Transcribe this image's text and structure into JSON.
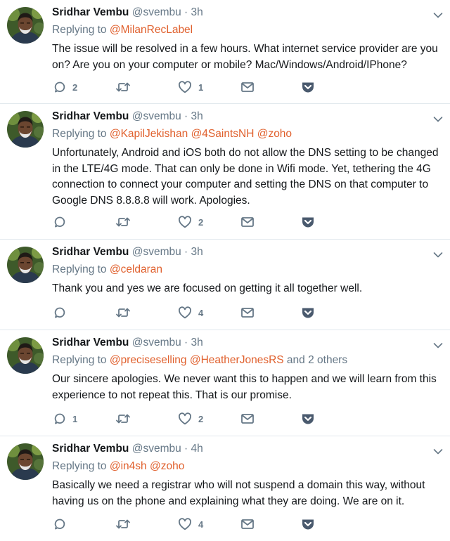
{
  "tweets": [
    {
      "name": "Sridhar Vembu",
      "handle": "@svembu",
      "sep": "·",
      "time": "3h",
      "replying_label": "Replying to",
      "mentions": [
        "@MilanRecLabel"
      ],
      "others_text": "",
      "text": "The issue will be resolved in a few hours. What internet service provider are you on? Are you on your computer or mobile? Mac/Windows/Android/IPhone?",
      "reply_count": "2",
      "retweet_count": "",
      "like_count": "1"
    },
    {
      "name": "Sridhar Vembu",
      "handle": "@svembu",
      "sep": "·",
      "time": "3h",
      "replying_label": "Replying to",
      "mentions": [
        "@KapilJekishan",
        "@4SaintsNH",
        "@zoho"
      ],
      "others_text": "",
      "text": "Unfortunately, Android and iOS both do not allow the DNS setting to be changed in the LTE/4G mode. That can only be done in Wifi mode. Yet, tethering the 4G connection to connect your computer and setting the DNS on that computer to Google DNS 8.8.8.8 will work. Apologies.",
      "reply_count": "",
      "retweet_count": "",
      "like_count": "2"
    },
    {
      "name": "Sridhar Vembu",
      "handle": "@svembu",
      "sep": "·",
      "time": "3h",
      "replying_label": "Replying to",
      "mentions": [
        "@celdaran"
      ],
      "others_text": "",
      "text": "Thank you and yes we are focused on getting it all together well.",
      "reply_count": "",
      "retweet_count": "",
      "like_count": "4"
    },
    {
      "name": "Sridhar Vembu",
      "handle": "@svembu",
      "sep": "·",
      "time": "3h",
      "replying_label": "Replying to",
      "mentions": [
        "@preciseselling",
        "@HeatherJonesRS"
      ],
      "others_text": "and 2 others",
      "text": "Our sincere apologies. We never want this to happen and we will learn from this experience to not repeat this. That is our promise.",
      "reply_count": "1",
      "retweet_count": "",
      "like_count": "2"
    },
    {
      "name": "Sridhar Vembu",
      "handle": "@svembu",
      "sep": "·",
      "time": "4h",
      "replying_label": "Replying to",
      "mentions": [
        "@in4sh",
        "@zoho"
      ],
      "others_text": "",
      "text": "Basically we need a registrar who will not suspend a domain this way, without having us on the phone and explaining what they are doing. We are on it.",
      "reply_count": "",
      "retweet_count": "",
      "like_count": "4"
    }
  ],
  "icons": {
    "reply": "reply-icon",
    "retweet": "retweet-icon",
    "like": "heart-icon",
    "dm": "envelope-icon",
    "more": "pocket-icon",
    "caret": "chevron-down-icon"
  },
  "colors": {
    "mention": "#e0602d",
    "secondary_text": "#657786",
    "pocket": "#4a5a6e",
    "divider": "#e1e8ed"
  }
}
